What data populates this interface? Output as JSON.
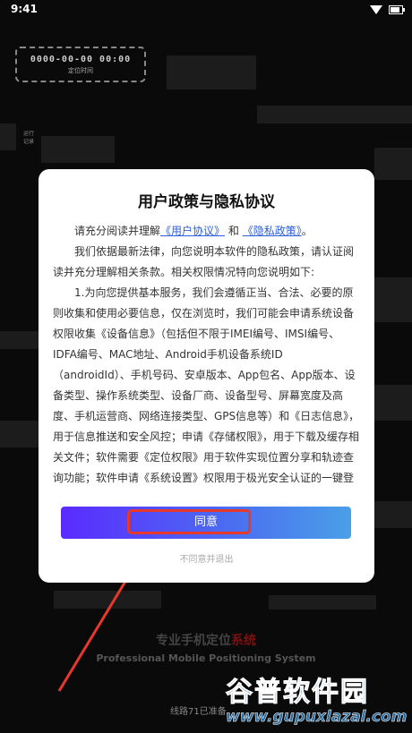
{
  "status_bar": {
    "time": "9:41",
    "wifi_icon": "wifi-icon",
    "battery_icon": "battery-icon"
  },
  "timer": {
    "value": "0000-00-00  00:00",
    "caption": "定位时间"
  },
  "mini_label": "运行\n记录",
  "dialog": {
    "title": "用户政策与隐私协议",
    "intro_prefix": "请充分阅读并理解",
    "user_agreement": "《用户协议》",
    "and_text": "和",
    "privacy_policy": "《隐私政策》",
    "intro_suffix": "。",
    "para2": "我们依据最新法律，向您说明本软件的隐私政策，请认证阅读并充分理解相关条款。相关权限情况特向您说明如下:",
    "para3": "1.为向您提供基本服务，我们会遵循正当、合法、必要的原则收集和使用必要信息，仅在浏览时，我们可能会申请系统设备权限收集《设备信息》（包括但不限于IMEI编号、IMSI编号、IDFA编号、MAC地址、Android手机设备系统ID（androidId）、手机号码、安卓版本、App包名、App版本、设备类型、操作系统类型、设备厂商、设备型号、屏幕宽度及高度、手机运营商、网络连接类型、GPS信息等）和《日志信息》，用于信息推送和安全风控；申请《存储权限》，用于下载及缓存相关文件；软件需要《定位权限》用于软件实现位置分享和轨迹查询功能；软件申请《系统设置》权限用于极光安全认证的一键登录；软件需要《通讯录权限》，软件首页通讯录导入帮助用户填写需要定位的手机号码；申",
    "agree_label": "同意",
    "decline_label": "不同意并退出"
  },
  "brand": {
    "prefix": "专业手机定位",
    "suffix": "系统"
  },
  "slogan": "Professional Mobile Positioning System",
  "line_status": "线路71已准备",
  "watermark": {
    "cn": "谷普软件园",
    "url": "www.gupuxlazal.com"
  },
  "colors": {
    "agree_start": "#5a2bff",
    "agree_end": "#4aa0e8",
    "link": "#2b5fd9",
    "highlight": "#e6382b"
  }
}
